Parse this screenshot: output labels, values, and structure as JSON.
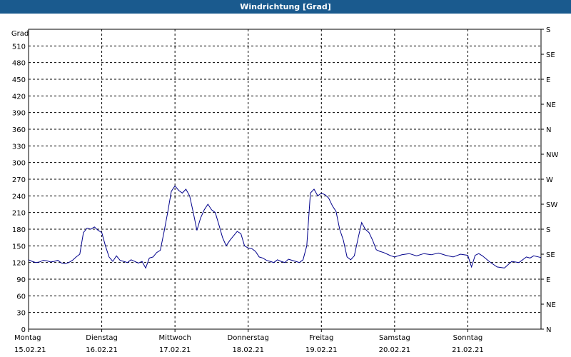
{
  "window": {
    "title": "Windrichtung [Grad]"
  },
  "chart_data": {
    "type": "line",
    "title": "Windrichtung [Grad]",
    "ylabel": "Grad",
    "xlabel": "",
    "ylim": [
      0,
      540
    ],
    "y_ticks": [
      0,
      30,
      60,
      90,
      120,
      150,
      180,
      210,
      240,
      270,
      300,
      330,
      360,
      390,
      420,
      450,
      480,
      510
    ],
    "right_axis_labels": [
      "N",
      "NE",
      "E",
      "SE",
      "S",
      "SW",
      "W",
      "NW",
      "N",
      "NE",
      "E",
      "SE",
      "S"
    ],
    "x_range_days": [
      0,
      7
    ],
    "x_ticks": [
      {
        "day": "Montag",
        "date": "15.02.21",
        "x": 0
      },
      {
        "day": "Dienstag",
        "date": "16.02.21",
        "x": 1
      },
      {
        "day": "Mittwoch",
        "date": "17.02.21",
        "x": 2
      },
      {
        "day": "Donnerstag",
        "date": "18.02.21",
        "x": 3
      },
      {
        "day": "Freitag",
        "date": "19.02.21",
        "x": 4
      },
      {
        "day": "Samstag",
        "date": "20.02.21",
        "x": 5
      },
      {
        "day": "Sonntag",
        "date": "21.02.21",
        "x": 6
      }
    ],
    "grid": true,
    "line_color": "#00008b",
    "series": [
      {
        "x": [
          0,
          0.05,
          0.1,
          0.15,
          0.2,
          0.25,
          0.3,
          0.35,
          0.4,
          0.45,
          0.5,
          0.55,
          0.6,
          0.65,
          0.7,
          0.75,
          0.8,
          0.85,
          0.9,
          0.95,
          1.0,
          1.05,
          1.1,
          1.15,
          1.2,
          1.25,
          1.3,
          1.35,
          1.4,
          1.45,
          1.5,
          1.55,
          1.6,
          1.65,
          1.7,
          1.75,
          1.8,
          1.85,
          1.9,
          1.95,
          2.0,
          2.05,
          2.1,
          2.15,
          2.2,
          2.25,
          2.3,
          2.35,
          2.4,
          2.45,
          2.5,
          2.55,
          2.6,
          2.65,
          2.7,
          2.75,
          2.8,
          2.85,
          2.9,
          2.95,
          3.0,
          3.05,
          3.1,
          3.15,
          3.2,
          3.25,
          3.3,
          3.35,
          3.4,
          3.45,
          3.5,
          3.55,
          3.6,
          3.65,
          3.7,
          3.75,
          3.8,
          3.85,
          3.9,
          3.95,
          4.0,
          4.05,
          4.1,
          4.15,
          4.2,
          4.25,
          4.3,
          4.35,
          4.4,
          4.45,
          4.5,
          4.55,
          4.6,
          4.65,
          4.7,
          4.75,
          4.8,
          4.85,
          4.9,
          4.95,
          5.0,
          5.1,
          5.2,
          5.3,
          5.4,
          5.5,
          5.6,
          5.7,
          5.8,
          5.9,
          6.0,
          6.05,
          6.1,
          6.15,
          6.2,
          6.3,
          6.4,
          6.5,
          6.6,
          6.7,
          6.8,
          6.85,
          6.9,
          7.0
        ],
        "y": [
          125,
          122,
          120,
          121,
          124,
          123,
          121,
          122,
          124,
          119,
          118,
          120,
          124,
          130,
          135,
          174,
          182,
          180,
          184,
          178,
          174,
          150,
          130,
          122,
          132,
          124,
          122,
          120,
          125,
          122,
          119,
          122,
          110,
          128,
          130,
          138,
          142,
          175,
          210,
          248,
          258,
          250,
          245,
          252,
          240,
          210,
          178,
          200,
          215,
          225,
          215,
          210,
          188,
          165,
          150,
          160,
          168,
          176,
          172,
          150,
          146,
          145,
          140,
          130,
          128,
          124,
          122,
          120,
          125,
          122,
          120,
          126,
          124,
          122,
          120,
          125,
          150,
          245,
          252,
          240,
          245,
          242,
          236,
          222,
          212,
          180,
          160,
          130,
          125,
          132,
          163,
          192,
          180,
          174,
          160,
          143,
          140,
          138,
          135,
          132,
          130,
          134,
          136,
          132,
          136,
          134,
          137,
          133,
          130,
          135,
          133,
          112,
          133,
          136,
          132,
          121,
          112,
          110,
          122,
          120,
          130,
          128,
          132,
          129
        ]
      }
    ]
  }
}
